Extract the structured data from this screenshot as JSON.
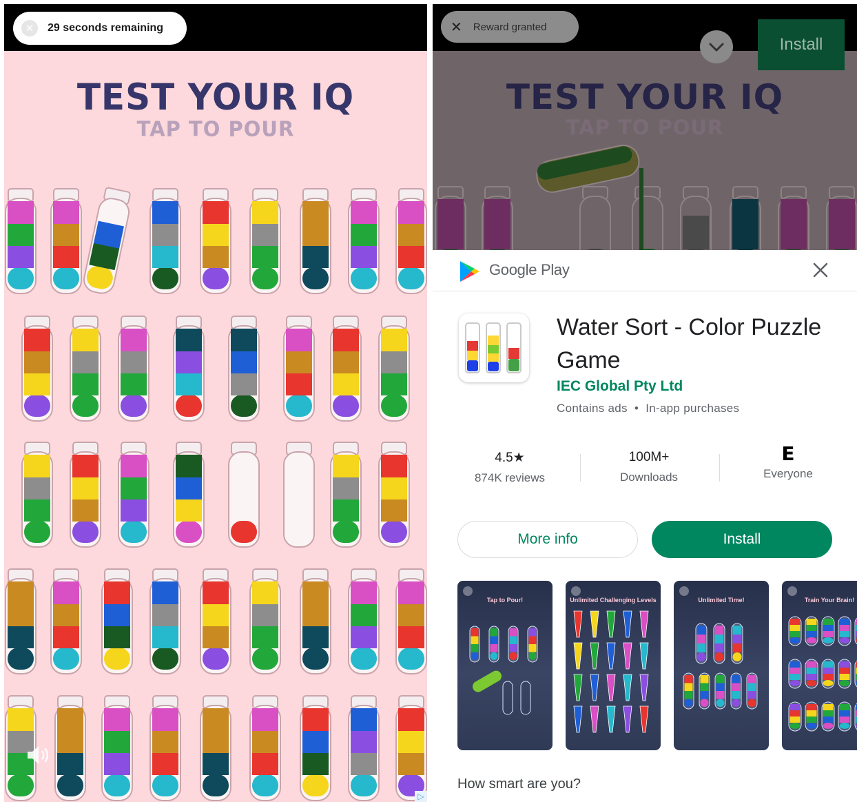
{
  "left_ad": {
    "timer_text": "29 seconds remaining",
    "title": "TEST YOUR IQ",
    "subtitle": "TAP TO POUR",
    "icons": [
      "close-icon",
      "sound-icon",
      "adchoices-icon"
    ]
  },
  "right_ad": {
    "reward_text": "Reward granted",
    "top_install_label": "Install",
    "title": "TEST YOUR IQ",
    "subtitle": "TAP TO POUR",
    "icons": [
      "close-icon",
      "chevron-down-icon"
    ]
  },
  "play_sheet": {
    "store_name": "Google Play",
    "app_title": "Water Sort - Color Puzzle Game",
    "developer": "IEC Global Pty Ltd",
    "ads_info": "Contains ads",
    "iap_info": "In-app purchases",
    "rating_value": "4.5★",
    "rating_label": "874K reviews",
    "downloads_value": "100M+",
    "downloads_label": "Downloads",
    "content_rating_symbol": "E",
    "content_rating_label": "Everyone",
    "more_info_label": "More info",
    "install_label": "Install",
    "screenshots": [
      {
        "caption": "Tap to Pour!"
      },
      {
        "caption": "Unlimited Challenging Levels"
      },
      {
        "caption": "Unlimited Time!"
      },
      {
        "caption": "Train Your Brain!"
      }
    ],
    "description_heading": "How smart are you?",
    "icons": [
      "google-play-logo-icon",
      "close-icon"
    ]
  },
  "colors": {
    "game_bg": "#fdd8dc",
    "play_green": "#01875f",
    "title_navy": "#37366b"
  }
}
